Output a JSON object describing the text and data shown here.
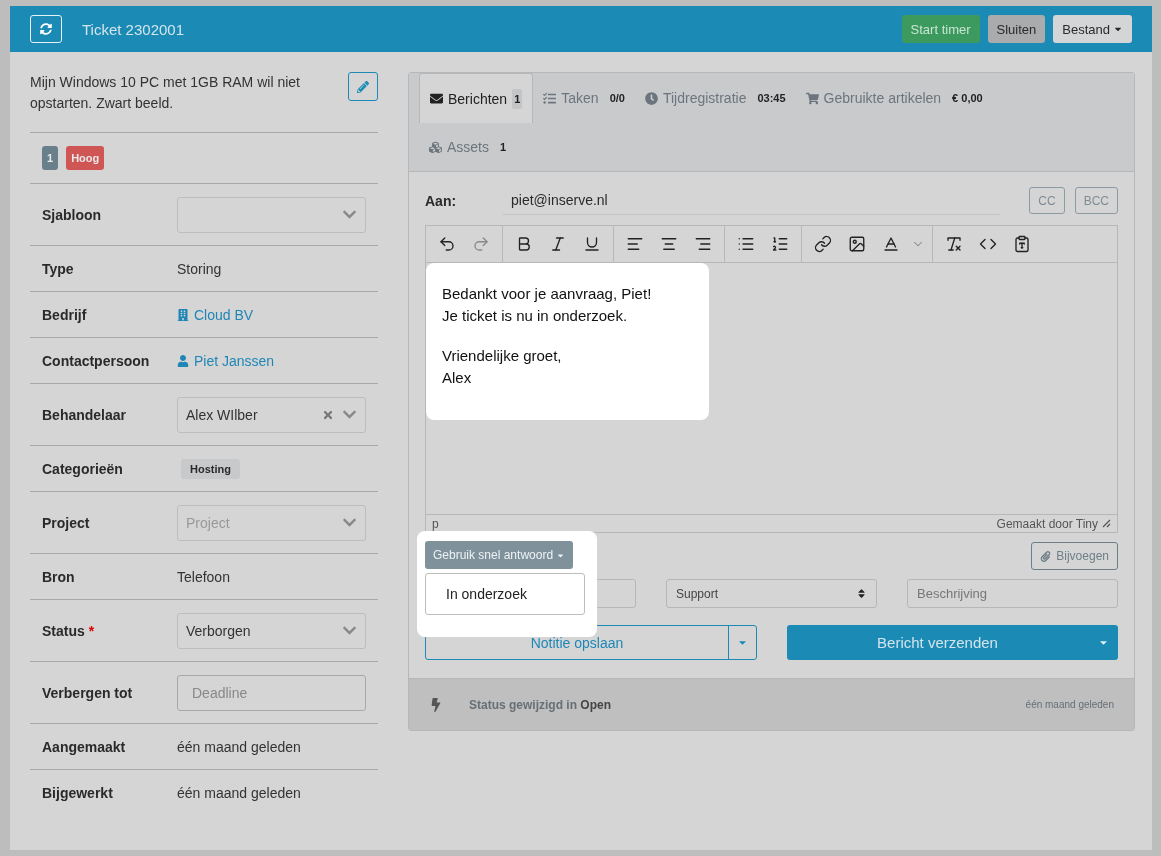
{
  "header": {
    "title": "Ticket 2302001",
    "buttons": [
      {
        "label": "Start timer",
        "kind": "success"
      },
      {
        "label": "Sluiten",
        "kind": "secondary"
      },
      {
        "label": "Bestand",
        "kind": "dropdown"
      }
    ]
  },
  "ticket": {
    "description": "Mijn Windows 10 PC met 1GB RAM wil niet opstarten. Zwart beeld.",
    "badges": [
      {
        "label": "1",
        "kind": "count"
      },
      {
        "label": "Hoog",
        "kind": "priority"
      }
    ],
    "fields": [
      {
        "label": "Sjabloon",
        "kind": "select"
      },
      {
        "label": "Type",
        "kind": "text",
        "value": "Storing"
      },
      {
        "label": "Bedrijf",
        "kind": "company",
        "value": "Cloud BV"
      },
      {
        "label": "Contactpersoon",
        "kind": "person",
        "value": "Piet Janssen"
      },
      {
        "label": "Behandelaar",
        "kind": "select",
        "value": "Alex WIlber",
        "clearable": true
      },
      {
        "label": "Categorieën",
        "kind": "tag",
        "value": "Hosting"
      },
      {
        "label": "Project",
        "kind": "select",
        "placeholder": "Project"
      },
      {
        "label": "Bron",
        "kind": "text",
        "value": "Telefoon"
      },
      {
        "label": "Status",
        "kind": "select",
        "value": "Verborgen",
        "required_mark": "*"
      },
      {
        "label": "Verbergen tot",
        "kind": "input",
        "placeholder": "Deadline"
      },
      {
        "label": "Aangemaakt",
        "kind": "text",
        "value": "één maand geleden"
      },
      {
        "label": "Bijgewerkt",
        "kind": "text",
        "value": "één maand geleden"
      }
    ]
  },
  "tabs": [
    {
      "label": "Berichten",
      "count": "1",
      "kind": "mail",
      "selected": true
    },
    {
      "label": "Taken",
      "count": "0/0",
      "kind": "tasks",
      "selected": false
    },
    {
      "label": "Tijdregistratie",
      "count": "03:45",
      "kind": "clock",
      "selected": false
    },
    {
      "label": "Gebruikte artikelen",
      "count": "€ 0,00",
      "kind": "cart",
      "selected": false
    },
    {
      "label": "Assets",
      "count": "1",
      "kind": "cubes",
      "selected": false
    }
  ],
  "composer": {
    "to_label": "Aan:",
    "to_value": "piet@inserve.nl",
    "copy_buttons": [
      "CC",
      "BCC"
    ],
    "body": [
      [
        "Bedankt voor je aanvraag, Piet!",
        "Je ticket is nu in onderzoek."
      ],
      [
        "Vriendelijke groet,",
        "Alex"
      ]
    ],
    "path": "p",
    "branding": "Gemaakt door Tiny",
    "quick_reply": {
      "label": "Gebruik snel antwoord",
      "options": [
        "In onderzoek"
      ]
    },
    "attach": "Bijvoegen",
    "queue": "Support",
    "description_placeholder": "Beschrijving",
    "note_button": "Notitie opslaan",
    "send_button": "Bericht verzenden"
  },
  "activity": [
    {
      "text": "Status gewijzigd in **Open**",
      "time": "één maand geleden"
    }
  ]
}
